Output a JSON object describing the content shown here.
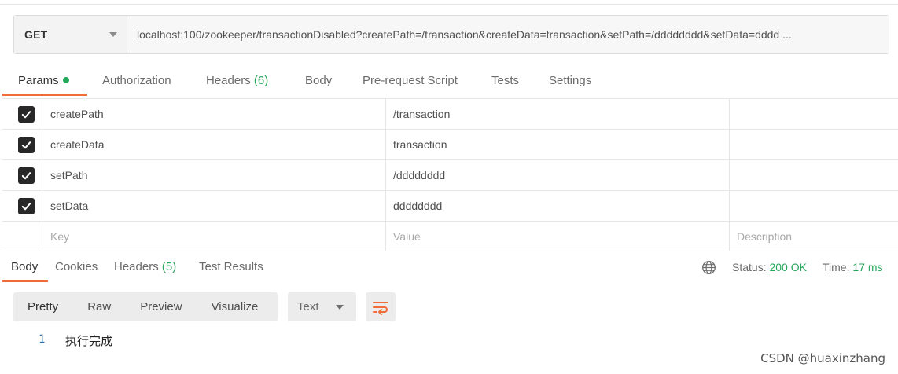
{
  "request": {
    "method": "GET",
    "url": "localhost:100/zookeeper/transactionDisabled?createPath=/transaction&createData=transaction&setPath=/dddddddd&setData=dddd ..."
  },
  "request_tabs": [
    {
      "label": "Params",
      "has_dot": true,
      "active": true
    },
    {
      "label": "Authorization"
    },
    {
      "label": "Headers",
      "count": "(6)"
    },
    {
      "label": "Body"
    },
    {
      "label": "Pre-request Script"
    },
    {
      "label": "Tests"
    },
    {
      "label": "Settings"
    }
  ],
  "params": [
    {
      "checked": true,
      "key": "createPath",
      "value": "/transaction",
      "description": ""
    },
    {
      "checked": true,
      "key": "createData",
      "value": "transaction",
      "description": ""
    },
    {
      "checked": true,
      "key": "setPath",
      "value": "/dddddddd",
      "description": ""
    },
    {
      "checked": true,
      "key": "setData",
      "value": "dddddddd",
      "description": ""
    }
  ],
  "params_placeholder": {
    "key": "Key",
    "value": "Value",
    "description": "Description"
  },
  "response_tabs": [
    {
      "label": "Body",
      "active": true
    },
    {
      "label": "Cookies"
    },
    {
      "label": "Headers",
      "count": "(5)"
    },
    {
      "label": "Test Results"
    }
  ],
  "response_status": {
    "status_label": "Status:",
    "status_value": "200 OK",
    "time_label": "Time:",
    "time_value": "17 ms"
  },
  "view_modes": [
    "Pretty",
    "Raw",
    "Preview",
    "Visualize"
  ],
  "format": "Text",
  "response_body": [
    {
      "line": "1",
      "text": "执行完成"
    }
  ],
  "watermark": "CSDN @huaxinzhang",
  "colors": {
    "accent": "#f26b3a",
    "success": "#26a65b",
    "line_number": "#2d6fa8"
  }
}
